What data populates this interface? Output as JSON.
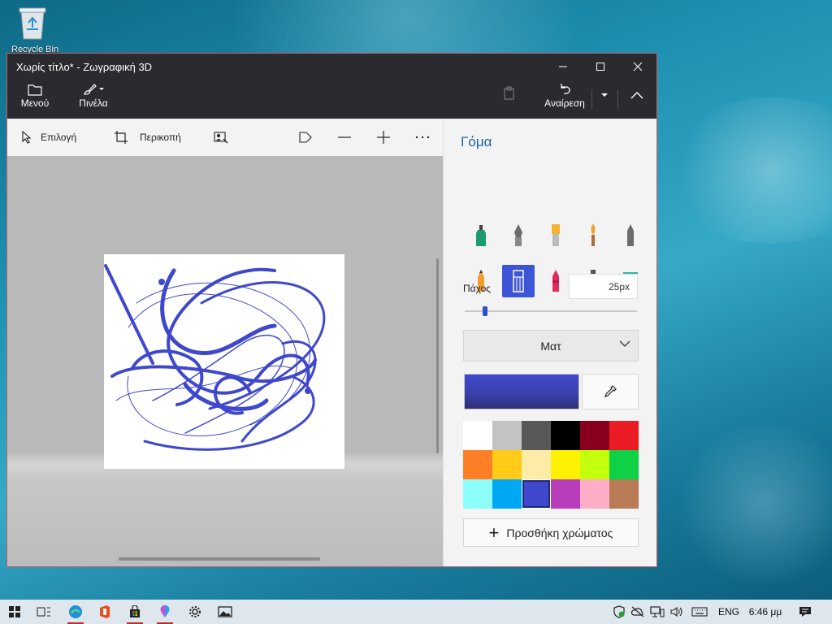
{
  "desktop": {
    "recycle_bin_label": "Recycle Bin"
  },
  "window": {
    "title": "Χωρίς τίτλο* - Ζωγραφική 3D",
    "minimize": "minimize",
    "maximize": "maximize",
    "close": "close"
  },
  "ribbon": {
    "menu_label": "Μενού",
    "brushes_label": "Πινέλα",
    "undo_label": "Αναίρεση"
  },
  "toolbar": {
    "select_label": "Επιλογή",
    "crop_label": "Περικοπή"
  },
  "panel": {
    "title": "Γόμα",
    "thickness_label": "Πάχος",
    "thickness_value": "25px",
    "thickness_level": 0.12,
    "finish_label": "Ματ",
    "current_color": "#3f48cc",
    "add_color_label": "Προσθήκη χρώματος",
    "brushes": [
      {
        "name": "marker-icon",
        "color": "#1f9a6e"
      },
      {
        "name": "calligraphy-pen-icon",
        "color": "#6b6b6b"
      },
      {
        "name": "oil-brush-icon",
        "color": "#f2b233"
      },
      {
        "name": "watercolor-icon",
        "color": "#f0a030"
      },
      {
        "name": "pixel-pen-icon",
        "color": "#6b6b6b"
      },
      {
        "name": "pencil-icon",
        "color": "#f0a030"
      },
      {
        "name": "eraser-icon",
        "color": "#ffffff"
      },
      {
        "name": "crayon-icon",
        "color": "#e02a5c"
      },
      {
        "name": "spray-can-icon",
        "color": "#f07a20"
      },
      {
        "name": "fill-bucket-icon",
        "color": "#2bb8a8"
      }
    ],
    "palette": [
      "#ffffff",
      "#c3c3c3",
      "#585858",
      "#000000",
      "#88001b",
      "#ec1c24",
      "#ff7f27",
      "#ffca18",
      "#fdeca6",
      "#fff200",
      "#c4ff0e",
      "#0ed145",
      "#8cfffb",
      "#00a8f3",
      "#3f48cc",
      "#b83dba",
      "#ffaec8",
      "#b97a56"
    ],
    "selected_swatch": 14
  },
  "taskbar": {
    "language": "ENG",
    "time": "6:46 μμ"
  }
}
